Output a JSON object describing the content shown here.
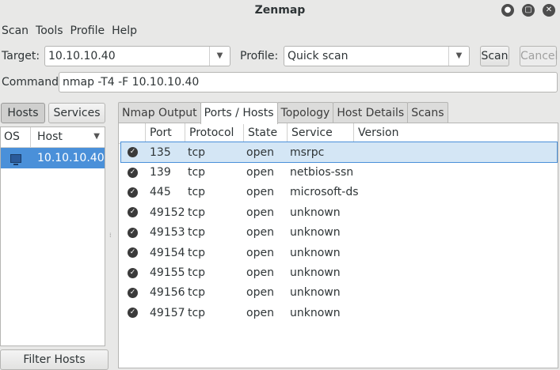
{
  "window": {
    "title": "Zenmap"
  },
  "window_controls": {
    "minimize": "●",
    "maximize": "▢",
    "close": "✕"
  },
  "menu": [
    "Scan",
    "Tools",
    "Profile",
    "Help"
  ],
  "target": {
    "label": "Target:",
    "value": "10.10.10.40"
  },
  "profile": {
    "label": "Profile:",
    "value": "Quick scan"
  },
  "buttons": {
    "scan": "Scan",
    "cancel": "Cancel"
  },
  "command": {
    "label": "Command:",
    "value": "nmap -T4 -F 10.10.10.40"
  },
  "left": {
    "hosts_button": "Hosts",
    "services_button": "Services",
    "columns": {
      "os": "OS",
      "host": "Host"
    },
    "hosts": [
      "10.10.10.40"
    ],
    "filter_button": "Filter Hosts"
  },
  "tabs": [
    "Nmap Output",
    "Ports / Hosts",
    "Topology",
    "Host Details",
    "Scans"
  ],
  "active_tab": "Ports / Hosts",
  "table": {
    "columns": [
      "Port",
      "Protocol",
      "State",
      "Service",
      "Version"
    ],
    "rows": [
      {
        "port": "135",
        "protocol": "tcp",
        "state": "open",
        "service": "msrpc",
        "version": ""
      },
      {
        "port": "139",
        "protocol": "tcp",
        "state": "open",
        "service": "netbios-ssn",
        "version": ""
      },
      {
        "port": "445",
        "protocol": "tcp",
        "state": "open",
        "service": "microsoft-ds",
        "version": ""
      },
      {
        "port": "49152",
        "protocol": "tcp",
        "state": "open",
        "service": "unknown",
        "version": ""
      },
      {
        "port": "49153",
        "protocol": "tcp",
        "state": "open",
        "service": "unknown",
        "version": ""
      },
      {
        "port": "49154",
        "protocol": "tcp",
        "state": "open",
        "service": "unknown",
        "version": ""
      },
      {
        "port": "49155",
        "protocol": "tcp",
        "state": "open",
        "service": "unknown",
        "version": ""
      },
      {
        "port": "49156",
        "protocol": "tcp",
        "state": "open",
        "service": "unknown",
        "version": ""
      },
      {
        "port": "49157",
        "protocol": "tcp",
        "state": "open",
        "service": "unknown",
        "version": ""
      }
    ]
  }
}
